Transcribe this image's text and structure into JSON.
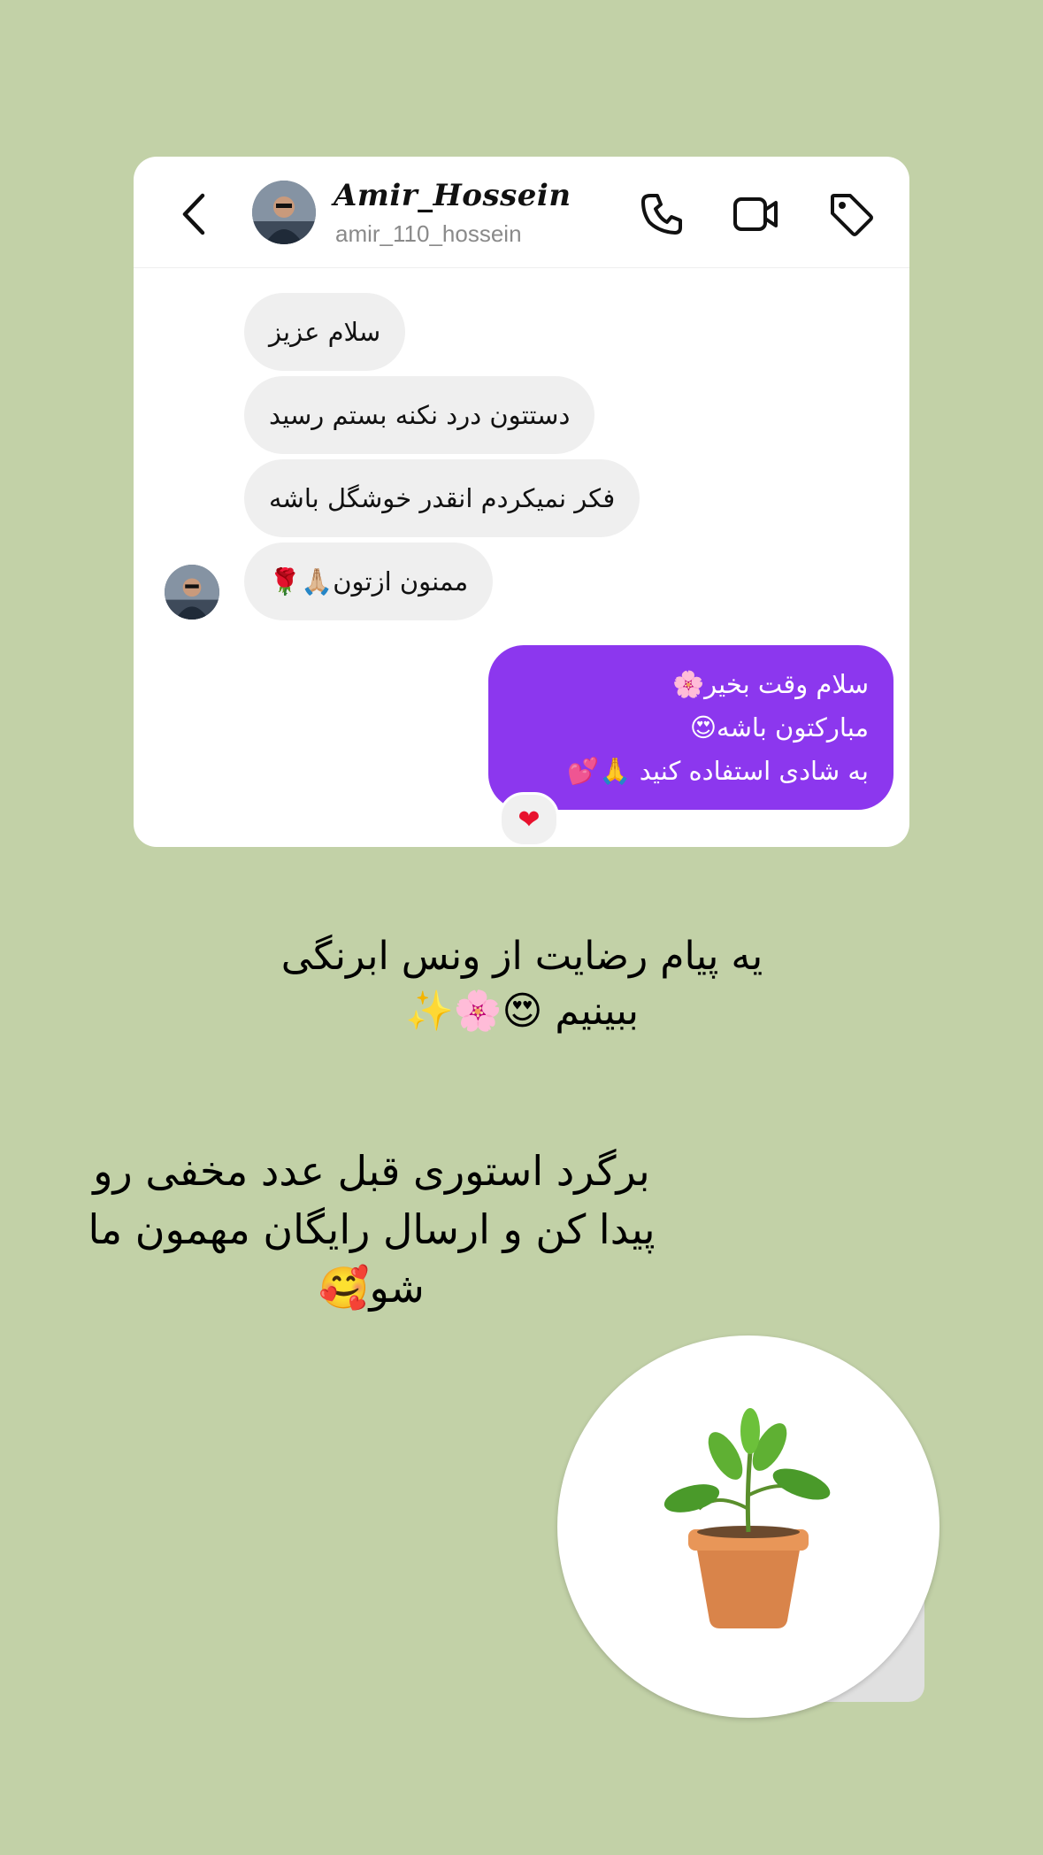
{
  "header": {
    "name": "Amir_Hossein",
    "handle": "amir_110_hossein"
  },
  "messages": {
    "incoming": [
      "سلام عزیز",
      "دستتون درد نکنه بستم رسید",
      "فکر نمیکردم انقدر خوشگل باشه",
      "ممنون ازتون🙏🏼🌹"
    ],
    "outgoing": [
      "سلام وقت بخیر🌸",
      "مبارکتون باشه😍",
      "به شادی استفاده کنید 🙏💕"
    ],
    "reaction": "❤"
  },
  "captions": {
    "line1": "یه پیام رضایت از ونس ابرنگی ببینیم 😍🌸✨",
    "line2": "برگرد استوری قبل عدد مخفی رو پیدا کن و ارسال رایگان مهمون ما شو🥰"
  },
  "colors": {
    "background": "#c2d1a7",
    "outgoing_bubble": "#8c37ee",
    "incoming_bubble": "#efefef"
  },
  "icons": [
    "back-arrow-icon",
    "phone-icon",
    "video-camera-icon",
    "tag-icon",
    "potted-plant-icon"
  ]
}
